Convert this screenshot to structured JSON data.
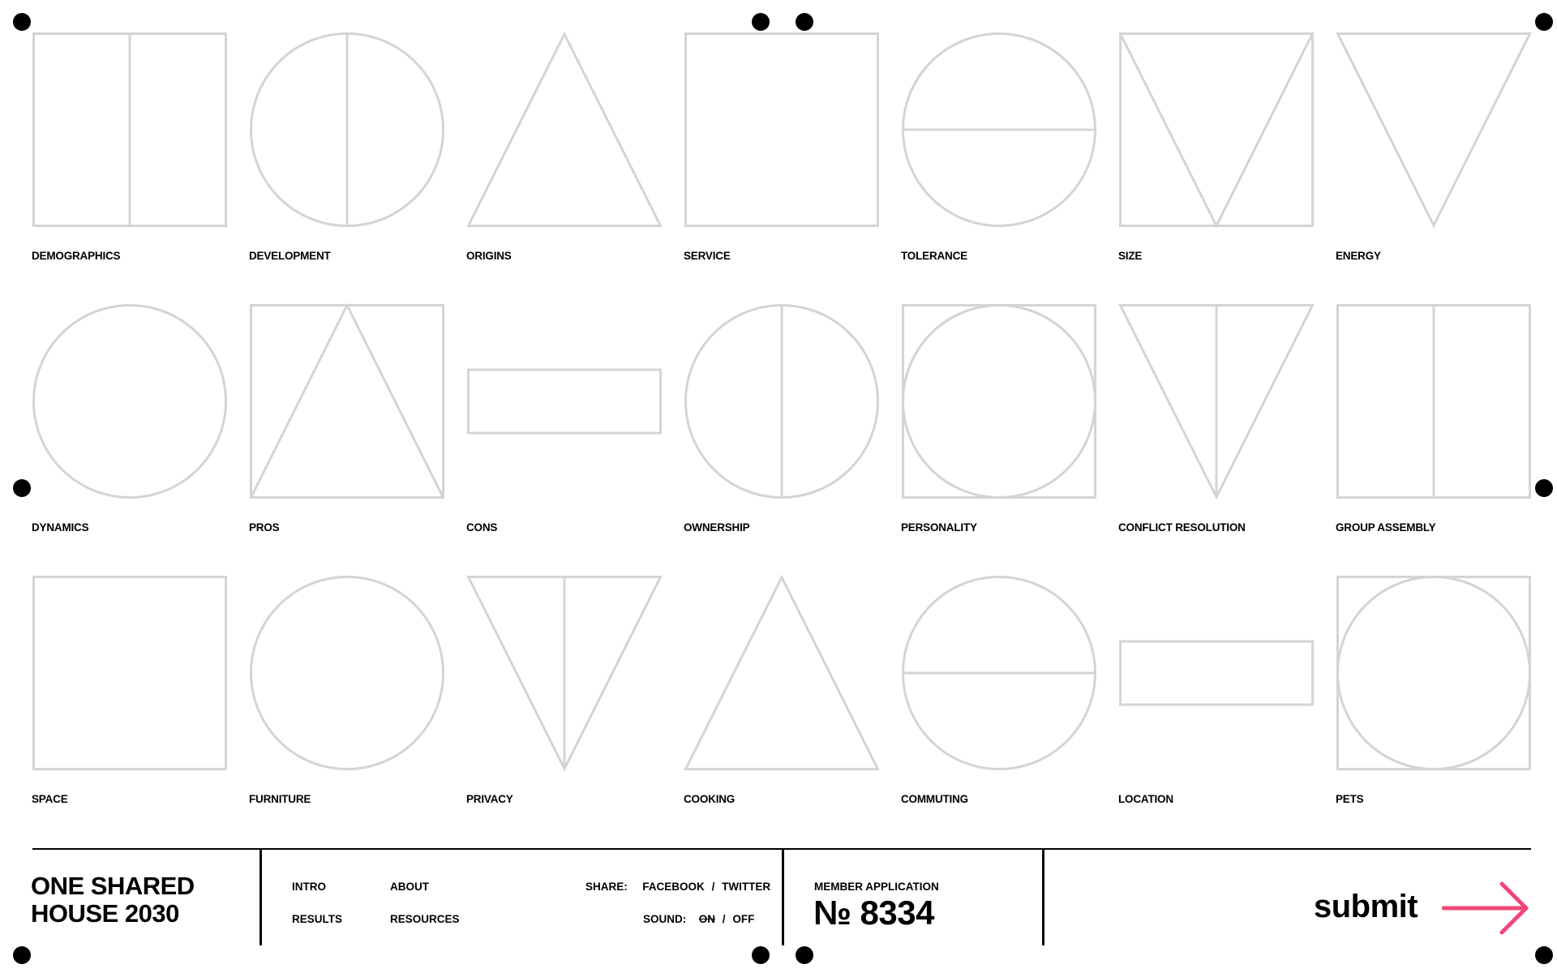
{
  "categories": [
    {
      "label": "DEMOGRAPHICS",
      "icon": "square-split-vertical-icon"
    },
    {
      "label": "DEVELOPMENT",
      "icon": "circle-split-vertical-icon"
    },
    {
      "label": "ORIGINS",
      "icon": "triangle-up-icon"
    },
    {
      "label": "SERVICE",
      "icon": "square-icon"
    },
    {
      "label": "TOLERANCE",
      "icon": "circle-split-horizontal-icon"
    },
    {
      "label": "SIZE",
      "icon": "square-with-inverted-triangle-icon"
    },
    {
      "label": "ENERGY",
      "icon": "triangle-down-icon"
    },
    {
      "label": "DYNAMICS",
      "icon": "circle-icon"
    },
    {
      "label": "PROS",
      "icon": "square-with-triangle-icon"
    },
    {
      "label": "CONS",
      "icon": "rectangle-icon"
    },
    {
      "label": "OWNERSHIP",
      "icon": "circle-split-vertical-icon"
    },
    {
      "label": "PERSONALITY",
      "icon": "square-with-circle-icon"
    },
    {
      "label": "CONFLICT RESOLUTION",
      "icon": "triangle-down-split-icon"
    },
    {
      "label": "GROUP ASSEMBLY",
      "icon": "square-split-vertical-icon"
    },
    {
      "label": "SPACE",
      "icon": "square-icon"
    },
    {
      "label": "FURNITURE",
      "icon": "circle-icon"
    },
    {
      "label": "PRIVACY",
      "icon": "triangle-down-split-icon"
    },
    {
      "label": "COOKING",
      "icon": "triangle-up-icon"
    },
    {
      "label": "COMMUTING",
      "icon": "circle-split-horizontal-icon"
    },
    {
      "label": "LOCATION",
      "icon": "rectangle-icon"
    },
    {
      "label": "PETS",
      "icon": "square-with-circle-icon"
    }
  ],
  "footer": {
    "brand_line1": "ONE SHARED",
    "brand_line2": "HOUSE 2030",
    "nav": {
      "intro": "INTRO",
      "about": "ABOUT",
      "results": "RESULTS",
      "resources": "RESOURCES"
    },
    "share_label": "SHARE:",
    "facebook": "FACEBOOK",
    "slash": "/",
    "twitter": "TWITTER",
    "sound_label": "SOUND:",
    "sound_on": "ON",
    "sound_off": "OFF",
    "member_label": "MEMBER APPLICATION",
    "member_number": "№ 8334",
    "submit_label": "submit"
  },
  "colors": {
    "shape_stroke": "#d4d4d4",
    "text": "#000000",
    "accent": "#f0477a",
    "background": "#ffffff"
  }
}
